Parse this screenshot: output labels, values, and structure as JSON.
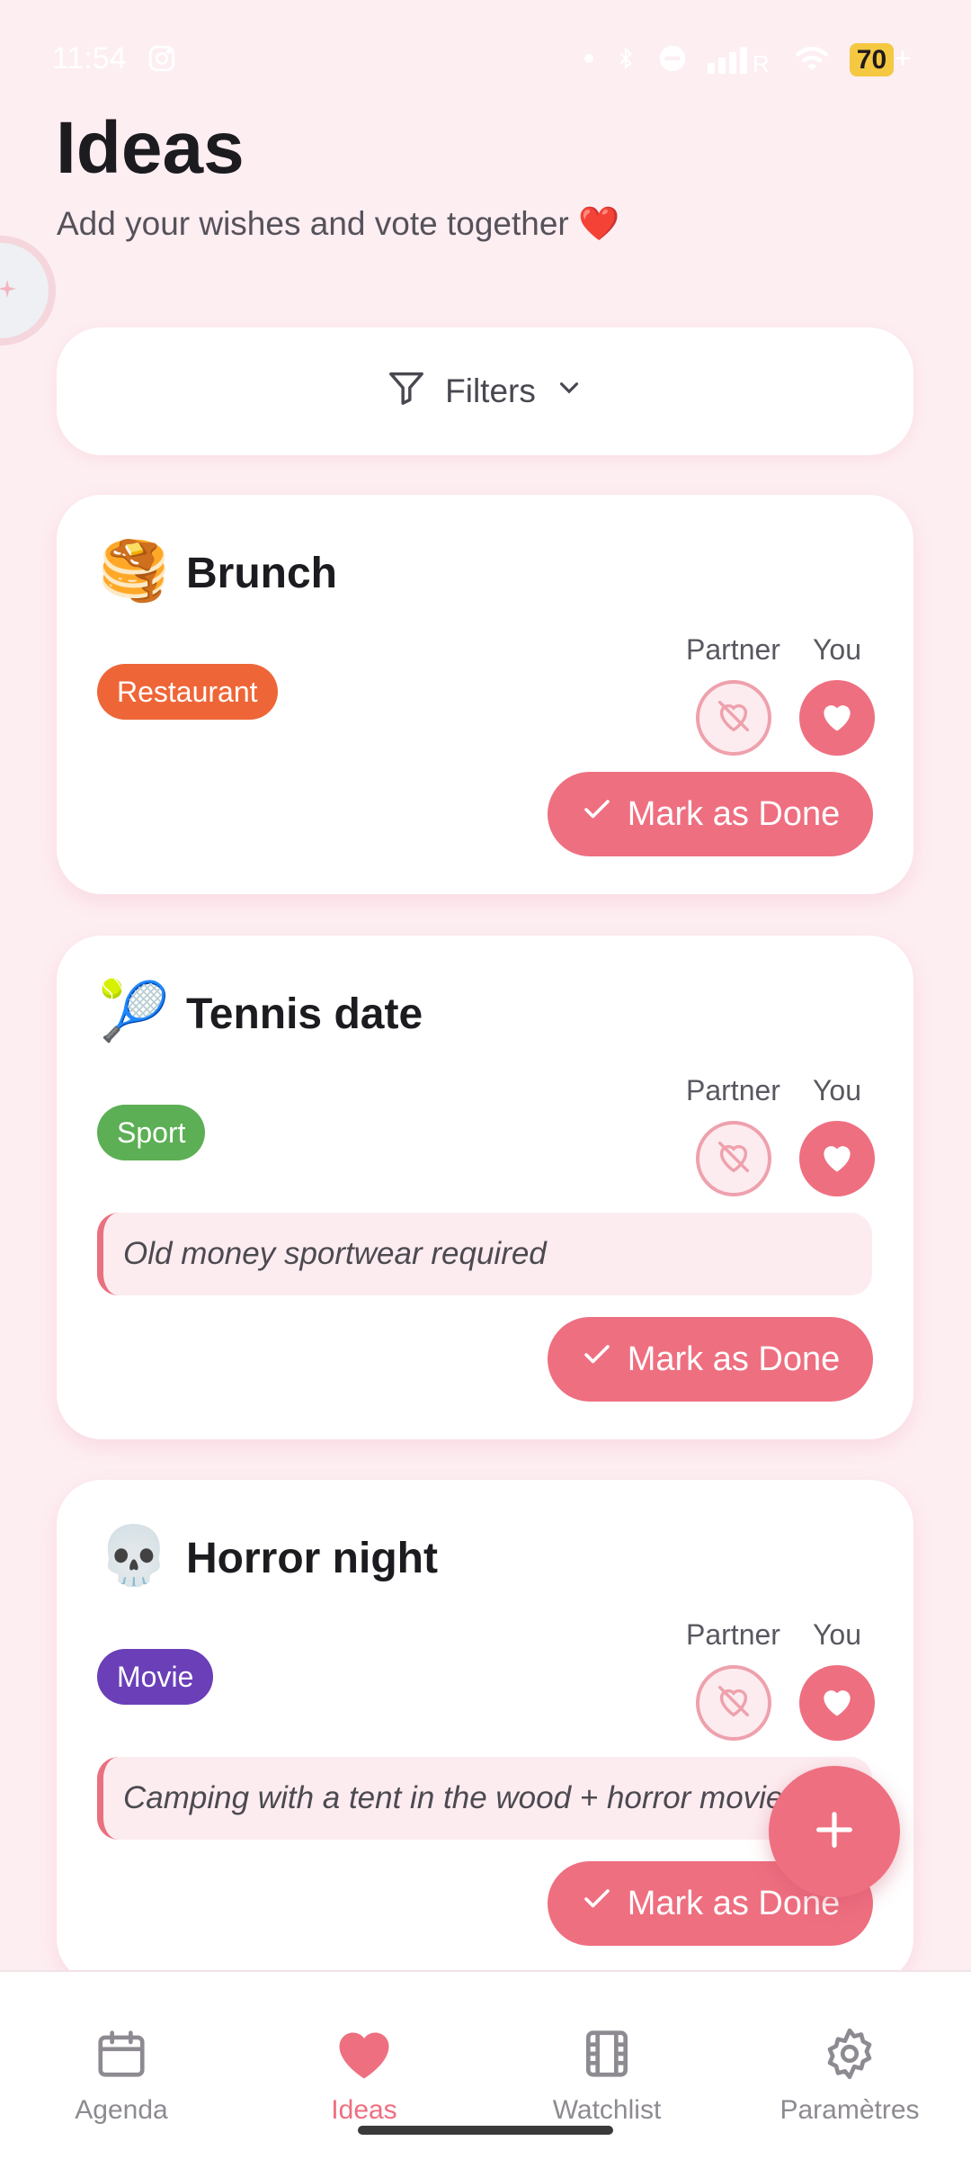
{
  "status_bar": {
    "time": "11:54",
    "battery": "70",
    "battery_suffix": "+"
  },
  "header": {
    "title": "Ideas",
    "subtitle": "Add your wishes and vote together ❤️"
  },
  "filters": {
    "label": "Filters"
  },
  "vote_labels": {
    "partner": "Partner",
    "you": "You"
  },
  "ideas": [
    {
      "emoji": "🥞",
      "title": "Brunch",
      "tag": "Restaurant",
      "tag_color": "#ee6637",
      "note": "",
      "action": "Mark as Done"
    },
    {
      "emoji": "🎾",
      "title": "Tennis date",
      "tag": "Sport",
      "tag_color": "#5caf54",
      "note": "Old money sportwear required",
      "action": "Mark as Done"
    },
    {
      "emoji": "💀",
      "title": "Horror night",
      "tag": "Movie",
      "tag_color": "#6a3fb8",
      "note": "Camping with a tent in the wood + horror movie",
      "action": "Mark as Done"
    }
  ],
  "fab": {
    "icon": "plus-icon"
  },
  "nav": {
    "items": [
      {
        "label": "Agenda",
        "icon": "calendar-icon",
        "active": false
      },
      {
        "label": "Ideas",
        "icon": "heart-icon",
        "active": true
      },
      {
        "label": "Watchlist",
        "icon": "film-icon",
        "active": false
      },
      {
        "label": "Paramètres",
        "icon": "gear-icon",
        "active": false
      }
    ]
  },
  "colors": {
    "accent": "#ee6f80",
    "background": "#fdeef2"
  }
}
